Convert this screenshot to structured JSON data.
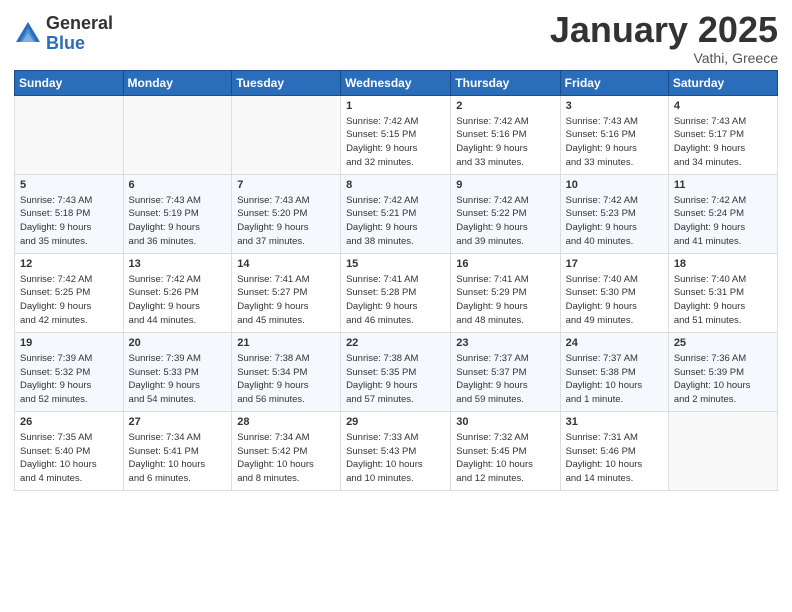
{
  "header": {
    "logo_general": "General",
    "logo_blue": "Blue",
    "month_title": "January 2025",
    "location": "Vathi, Greece"
  },
  "weekdays": [
    "Sunday",
    "Monday",
    "Tuesday",
    "Wednesday",
    "Thursday",
    "Friday",
    "Saturday"
  ],
  "weeks": [
    [
      {
        "day": "",
        "info": ""
      },
      {
        "day": "",
        "info": ""
      },
      {
        "day": "",
        "info": ""
      },
      {
        "day": "1",
        "info": "Sunrise: 7:42 AM\nSunset: 5:15 PM\nDaylight: 9 hours\nand 32 minutes."
      },
      {
        "day": "2",
        "info": "Sunrise: 7:42 AM\nSunset: 5:16 PM\nDaylight: 9 hours\nand 33 minutes."
      },
      {
        "day": "3",
        "info": "Sunrise: 7:43 AM\nSunset: 5:16 PM\nDaylight: 9 hours\nand 33 minutes."
      },
      {
        "day": "4",
        "info": "Sunrise: 7:43 AM\nSunset: 5:17 PM\nDaylight: 9 hours\nand 34 minutes."
      }
    ],
    [
      {
        "day": "5",
        "info": "Sunrise: 7:43 AM\nSunset: 5:18 PM\nDaylight: 9 hours\nand 35 minutes."
      },
      {
        "day": "6",
        "info": "Sunrise: 7:43 AM\nSunset: 5:19 PM\nDaylight: 9 hours\nand 36 minutes."
      },
      {
        "day": "7",
        "info": "Sunrise: 7:43 AM\nSunset: 5:20 PM\nDaylight: 9 hours\nand 37 minutes."
      },
      {
        "day": "8",
        "info": "Sunrise: 7:42 AM\nSunset: 5:21 PM\nDaylight: 9 hours\nand 38 minutes."
      },
      {
        "day": "9",
        "info": "Sunrise: 7:42 AM\nSunset: 5:22 PM\nDaylight: 9 hours\nand 39 minutes."
      },
      {
        "day": "10",
        "info": "Sunrise: 7:42 AM\nSunset: 5:23 PM\nDaylight: 9 hours\nand 40 minutes."
      },
      {
        "day": "11",
        "info": "Sunrise: 7:42 AM\nSunset: 5:24 PM\nDaylight: 9 hours\nand 41 minutes."
      }
    ],
    [
      {
        "day": "12",
        "info": "Sunrise: 7:42 AM\nSunset: 5:25 PM\nDaylight: 9 hours\nand 42 minutes."
      },
      {
        "day": "13",
        "info": "Sunrise: 7:42 AM\nSunset: 5:26 PM\nDaylight: 9 hours\nand 44 minutes."
      },
      {
        "day": "14",
        "info": "Sunrise: 7:41 AM\nSunset: 5:27 PM\nDaylight: 9 hours\nand 45 minutes."
      },
      {
        "day": "15",
        "info": "Sunrise: 7:41 AM\nSunset: 5:28 PM\nDaylight: 9 hours\nand 46 minutes."
      },
      {
        "day": "16",
        "info": "Sunrise: 7:41 AM\nSunset: 5:29 PM\nDaylight: 9 hours\nand 48 minutes."
      },
      {
        "day": "17",
        "info": "Sunrise: 7:40 AM\nSunset: 5:30 PM\nDaylight: 9 hours\nand 49 minutes."
      },
      {
        "day": "18",
        "info": "Sunrise: 7:40 AM\nSunset: 5:31 PM\nDaylight: 9 hours\nand 51 minutes."
      }
    ],
    [
      {
        "day": "19",
        "info": "Sunrise: 7:39 AM\nSunset: 5:32 PM\nDaylight: 9 hours\nand 52 minutes."
      },
      {
        "day": "20",
        "info": "Sunrise: 7:39 AM\nSunset: 5:33 PM\nDaylight: 9 hours\nand 54 minutes."
      },
      {
        "day": "21",
        "info": "Sunrise: 7:38 AM\nSunset: 5:34 PM\nDaylight: 9 hours\nand 56 minutes."
      },
      {
        "day": "22",
        "info": "Sunrise: 7:38 AM\nSunset: 5:35 PM\nDaylight: 9 hours\nand 57 minutes."
      },
      {
        "day": "23",
        "info": "Sunrise: 7:37 AM\nSunset: 5:37 PM\nDaylight: 9 hours\nand 59 minutes."
      },
      {
        "day": "24",
        "info": "Sunrise: 7:37 AM\nSunset: 5:38 PM\nDaylight: 10 hours\nand 1 minute."
      },
      {
        "day": "25",
        "info": "Sunrise: 7:36 AM\nSunset: 5:39 PM\nDaylight: 10 hours\nand 2 minutes."
      }
    ],
    [
      {
        "day": "26",
        "info": "Sunrise: 7:35 AM\nSunset: 5:40 PM\nDaylight: 10 hours\nand 4 minutes."
      },
      {
        "day": "27",
        "info": "Sunrise: 7:34 AM\nSunset: 5:41 PM\nDaylight: 10 hours\nand 6 minutes."
      },
      {
        "day": "28",
        "info": "Sunrise: 7:34 AM\nSunset: 5:42 PM\nDaylight: 10 hours\nand 8 minutes."
      },
      {
        "day": "29",
        "info": "Sunrise: 7:33 AM\nSunset: 5:43 PM\nDaylight: 10 hours\nand 10 minutes."
      },
      {
        "day": "30",
        "info": "Sunrise: 7:32 AM\nSunset: 5:45 PM\nDaylight: 10 hours\nand 12 minutes."
      },
      {
        "day": "31",
        "info": "Sunrise: 7:31 AM\nSunset: 5:46 PM\nDaylight: 10 hours\nand 14 minutes."
      },
      {
        "day": "",
        "info": ""
      }
    ]
  ]
}
